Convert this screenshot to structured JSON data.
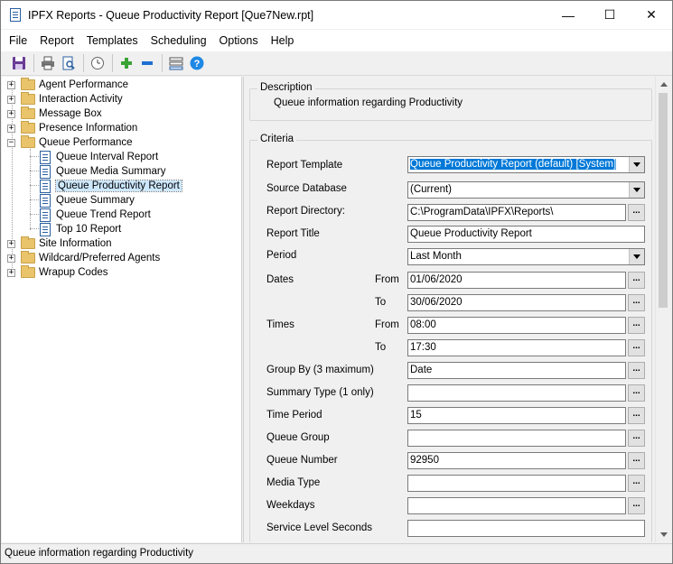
{
  "window": {
    "title": "IPFX Reports - Queue Productivity Report  [Que7New.rpt]",
    "minimize": "—",
    "maximize": "☐",
    "close": "✕"
  },
  "menu": {
    "items": [
      {
        "label": "File",
        "icon": "none"
      },
      {
        "label": "Report",
        "icon": "none"
      },
      {
        "label": "Templates",
        "icon": "none"
      },
      {
        "label": "Scheduling",
        "icon": "none"
      },
      {
        "label": "Options",
        "icon": "none"
      },
      {
        "label": "Help",
        "icon": "none"
      }
    ]
  },
  "toolbar": {
    "icons": [
      "save-icon",
      "print-icon",
      "print-preview-icon",
      "schedule-clock-icon",
      "add-icon",
      "remove-icon",
      "filter-icon",
      "help-icon"
    ]
  },
  "tree": {
    "nodes": [
      {
        "label": "Agent Performance",
        "type": "folder",
        "expander": "+"
      },
      {
        "label": "Interaction Activity",
        "type": "folder",
        "expander": "+"
      },
      {
        "label": "Message Box",
        "type": "folder",
        "expander": "+"
      },
      {
        "label": "Presence Information",
        "type": "folder",
        "expander": "+"
      },
      {
        "label": "Queue Performance",
        "type": "folder",
        "expander": "−"
      },
      {
        "label": "Queue Interval Report",
        "type": "report"
      },
      {
        "label": "Queue Media Summary",
        "type": "report"
      },
      {
        "label": "Queue Productivity Report",
        "type": "report",
        "selected": true
      },
      {
        "label": "Queue Summary",
        "type": "report"
      },
      {
        "label": "Queue Trend Report",
        "type": "report"
      },
      {
        "label": "Top 10 Report",
        "type": "report"
      },
      {
        "label": "Site Information",
        "type": "folder",
        "expander": "+"
      },
      {
        "label": "Wildcard/Preferred Agents",
        "type": "folder",
        "expander": "+"
      },
      {
        "label": "Wrapup Codes",
        "type": "folder",
        "expander": "+"
      }
    ]
  },
  "description": {
    "group_title": "Description",
    "text": "Queue information regarding Productivity"
  },
  "criteria": {
    "group_title": "Criteria",
    "report_template": {
      "label": "Report Template",
      "value": "Queue Productivity Report (default) [System]"
    },
    "source_database": {
      "label": "Source Database",
      "value": "(Current)"
    },
    "report_directory": {
      "label": "Report Directory:",
      "value": "C:\\ProgramData\\IPFX\\Reports\\"
    },
    "report_title": {
      "label": "Report Title",
      "value": "Queue Productivity Report"
    },
    "period": {
      "label": "Period",
      "value": "Last Month"
    },
    "dates": {
      "label": "Dates",
      "from_label": "From",
      "from_value": "01/06/2020",
      "to_label": "To",
      "to_value": "30/06/2020"
    },
    "times": {
      "label": "Times",
      "from_label": "From",
      "from_value": "08:00",
      "to_label": "To",
      "to_value": "17:30"
    },
    "group_by": {
      "label": "Group By (3 maximum)",
      "value": "Date"
    },
    "summary_type": {
      "label": "Summary Type (1 only)",
      "value": ""
    },
    "time_period": {
      "label": "Time Period",
      "value": "15"
    },
    "queue_group": {
      "label": "Queue Group",
      "value": ""
    },
    "queue_number": {
      "label": "Queue Number",
      "value": "92950"
    },
    "media_type": {
      "label": "Media Type",
      "value": ""
    },
    "weekdays": {
      "label": "Weekdays",
      "value": ""
    },
    "service_level_seconds": {
      "label": "Service Level Seconds",
      "value": ""
    },
    "ellipsis": "..."
  },
  "status_bar": {
    "text": "Queue information regarding Productivity"
  }
}
